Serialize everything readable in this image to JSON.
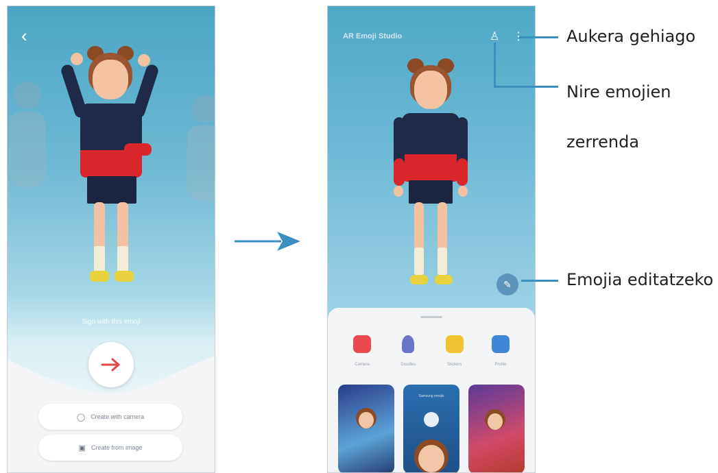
{
  "left_screen": {
    "prompt": "Sign with this emoji",
    "actions": [
      {
        "label": "Create with camera",
        "icon": "camera-icon"
      },
      {
        "label": "Create from image",
        "icon": "image-icon"
      }
    ]
  },
  "right_screen": {
    "app_title": "AR Emoji Studio",
    "menu": [
      {
        "label": "Camera",
        "icon": "camera-icon",
        "color": "#e8484e"
      },
      {
        "label": "Doodles",
        "icon": "mic-icon",
        "color": "#6a74c9"
      },
      {
        "label": "Stickers",
        "icon": "sticker-icon",
        "color": "#f2c233"
      },
      {
        "label": "Profile",
        "icon": "profile-icon",
        "color": "#3f86d6"
      }
    ],
    "card_caption": "Samsung emojis"
  },
  "callouts": {
    "more_options": "Aukera gehiago",
    "emoji_list_line1": "Nire emojien",
    "emoji_list_line2": "zerrenda",
    "edit_emoji": "Emojia editatzeko"
  },
  "colors": {
    "accent": "#3a8fbf",
    "next_arrow": "#e0474c",
    "sky_top": "#4aa6c5"
  }
}
